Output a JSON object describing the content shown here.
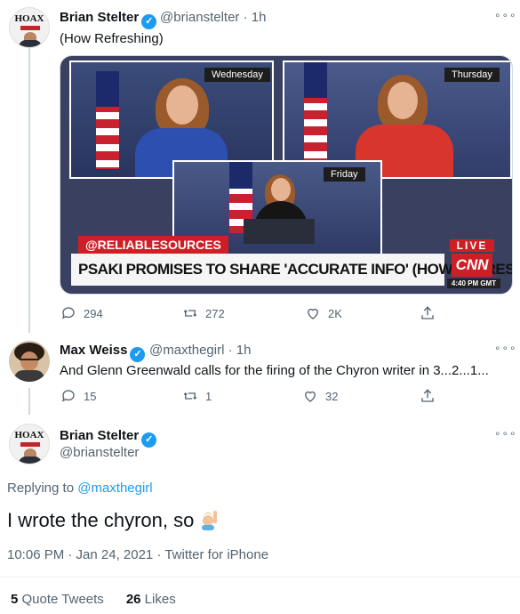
{
  "tweet1": {
    "name": "Brian Stelter",
    "handle": "@brianstelter",
    "time": "· 1h",
    "text": "(How Refreshing)",
    "media": {
      "day1": "Wednesday",
      "day2": "Thursday",
      "day3": "Friday",
      "tag": "@RELIABLESOURCES",
      "chyron": "PSAKI PROMISES TO SHARE 'ACCURATE INFO' (HOW REFRESHING)",
      "live": "LIVE",
      "network": "CNN",
      "clock": "4:40 PM GMT"
    },
    "actions": {
      "replies": "294",
      "retweets": "272",
      "likes": "2K"
    }
  },
  "tweet2": {
    "name": "Max Weiss",
    "handle": "@maxthegirl",
    "time": "· 1h",
    "text": "And Glenn Greenwald calls for the firing of the Chyron writer in 3...2...1...",
    "actions": {
      "replies": "15",
      "retweets": "1",
      "likes": "32"
    }
  },
  "main": {
    "name": "Brian Stelter",
    "handle": "@brianstelter",
    "replying_prefix": "Replying to ",
    "replying_to": "@maxthegirl",
    "text": "I wrote the chyron, so",
    "meta": "10:06 PM · Jan 24, 2021 · Twitter for iPhone",
    "quote_count": "5",
    "quote_label": "Quote Tweets",
    "like_count": "26",
    "like_label": "Likes"
  },
  "avatar_text": {
    "hoax": "HOAX"
  },
  "colors": {
    "accent": "#1d9bf0",
    "secondary_text": "#536471",
    "cnn_red": "#cf1f26"
  }
}
